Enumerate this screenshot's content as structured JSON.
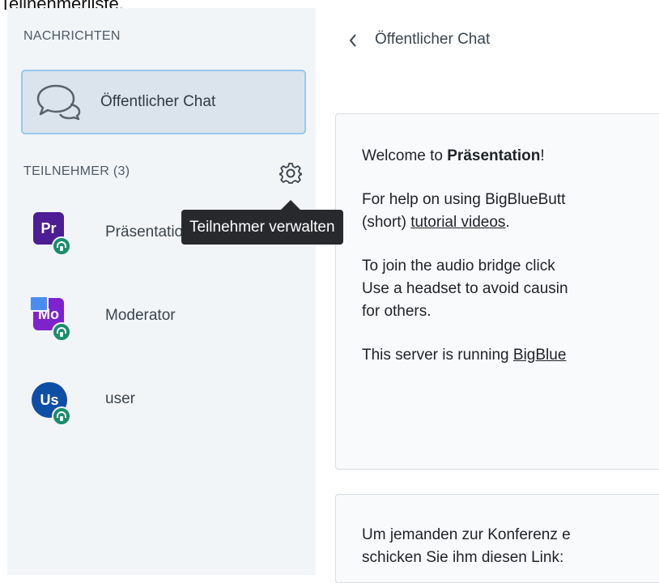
{
  "page_caption": "Teilnehmerliste.",
  "sidebar": {
    "messages_title": "NACHRICHTEN",
    "public_chat_label": "Öffentlicher Chat",
    "participants_title": "TEILNEHMER (3)",
    "users": [
      {
        "initials": "Pr",
        "name": "Präsentation (Du)",
        "avatar_color": "#4c1d95",
        "presenter": false
      },
      {
        "initials": "Mo",
        "name": "Moderator",
        "avatar_color": "#7e22ce",
        "presenter": true
      },
      {
        "initials": "Us",
        "name": "user",
        "avatar_color": "#0e4ea5",
        "presenter": false
      }
    ]
  },
  "tooltip": {
    "text": "Teilnehmer verwalten"
  },
  "chat": {
    "title": "Öffentlicher Chat",
    "welcome": {
      "line1_prefix": "Welcome to ",
      "line1_bold": "Präsentation",
      "line1_suffix": "!",
      "line2": "For help on using BigBlueButt",
      "line3_prefix": "(short) ",
      "line3_link": "tutorial videos",
      "line3_suffix": ".",
      "line4": "To join the audio bridge click",
      "line5": "Use a headset to avoid causin",
      "line6": "for others.",
      "line7_prefix": "This server is running ",
      "line7_link": "BigBlue"
    },
    "invite": {
      "line1": "Um jemanden zur Konferenz e",
      "line2": "schicken Sie ihm diesen Link:"
    }
  },
  "colors": {
    "sidebar_bg": "#f2f5f8",
    "selected_item_bg": "#dbe4ec",
    "selected_item_border": "#99c8ef",
    "audio_badge": "#1a8d6d",
    "tooltip_bg": "#27292c"
  }
}
